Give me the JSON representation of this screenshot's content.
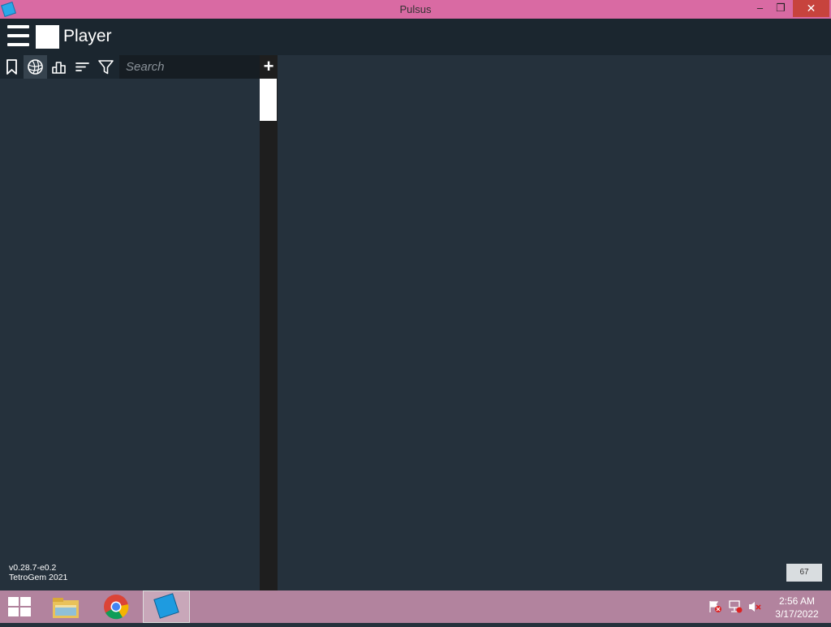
{
  "window": {
    "title": "Pulsus",
    "min_label": "–",
    "max_label": "❐",
    "close_label": "✕"
  },
  "header": {
    "title": "Player"
  },
  "toolbar": {
    "search_placeholder": "Search",
    "add_label": "+"
  },
  "footer": {
    "version": "v0.28.7-e0.2",
    "credit": "TetroGem 2021",
    "fps": "67"
  },
  "taskbar": {
    "time": "2:56 AM",
    "date": "3/17/2022"
  }
}
